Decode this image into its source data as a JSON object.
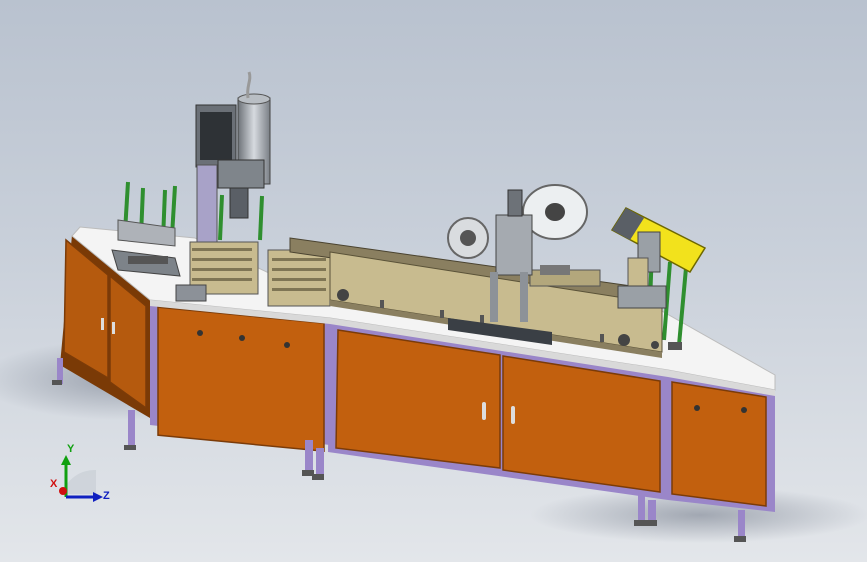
{
  "viewport": {
    "colors": {
      "frame": "#9a86c9",
      "panel": "#c2600e",
      "panel_dark": "#9c4a08",
      "tabletop": "#f4f4f4",
      "machine_khaki": "#c8bb8f",
      "machine_grey": "#9aa0a6",
      "green_rod": "#2f8f2f",
      "yellow_plate": "#f2e21c"
    }
  },
  "triad": {
    "x_label": "X",
    "y_label": "Y",
    "z_label": "Z",
    "colors": {
      "x": "#d01010",
      "y": "#10a010",
      "z": "#1020c0"
    }
  }
}
